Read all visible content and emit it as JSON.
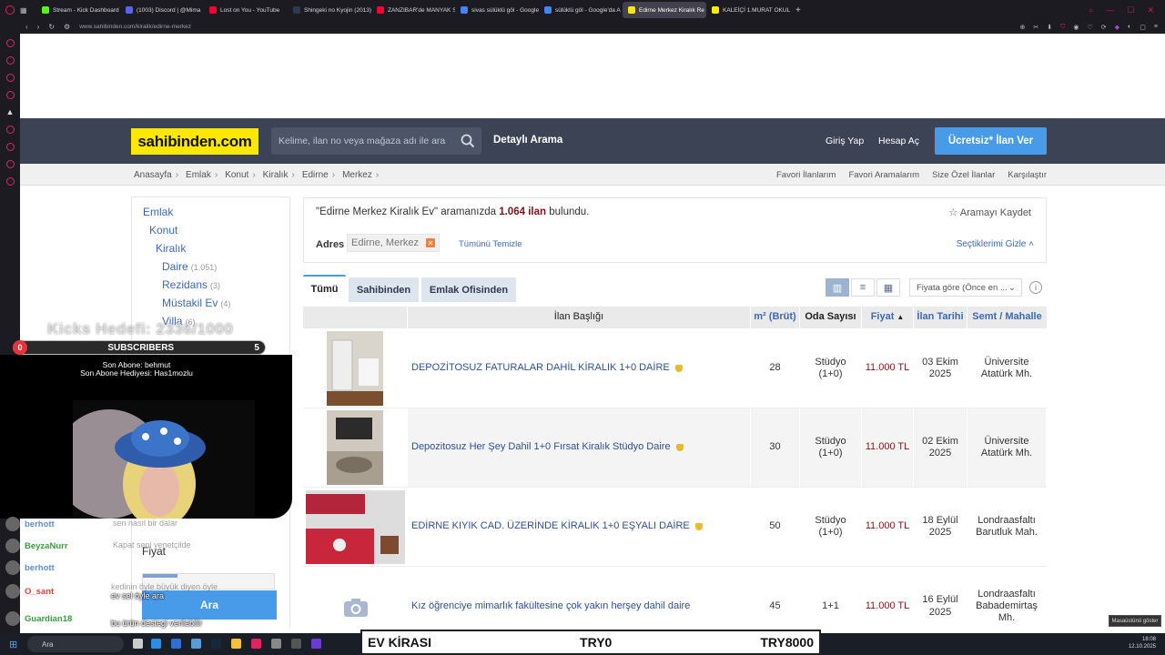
{
  "browser": {
    "tabs": [
      {
        "label": "Stream - Kick Dashboard",
        "color": "#53fc18"
      },
      {
        "label": "(1003) Discord | @Mima",
        "color": "#5865f2"
      },
      {
        "label": "Lost on You - YouTube",
        "color": "#ff0033"
      },
      {
        "label": "Shingeki no Kyojin (2013)",
        "color": "#2f3a52"
      },
      {
        "label": "ZANZIBAR'de MANYAK S",
        "color": "#ff0033"
      },
      {
        "label": "sivas sülüklü göl - Google",
        "color": "#4285f4"
      },
      {
        "label": "sülüklü göl - Google'da A",
        "color": "#4285f4"
      },
      {
        "label": "Edirne Merkez Kiralık Re",
        "color": "#ffe800"
      },
      {
        "label": "KALEİÇİ 1.MURAT OKULU",
        "color": "#ffe800"
      }
    ],
    "active_tab": 7,
    "new_tab": "+",
    "url": "www.sahibinden.com/kiralik/edirne-merkez"
  },
  "header": {
    "logo": "sahibinden.com",
    "search_placeholder": "Kelime, ilan no veya mağaza adı ile ara",
    "detailed_search": "Detaylı Arama",
    "login": "Giriş Yap",
    "register": "Hesap Aç",
    "post_ad": "Ücretsiz* İlan Ver"
  },
  "breadcrumb": {
    "items": [
      "Anasayfa",
      "Emlak",
      "Konut",
      "Kiralık",
      "Edirne",
      "Merkez"
    ],
    "right_links": [
      "Favori İlanlarım",
      "Favori Aramalarım",
      "Size Özel İlanlar",
      "Karşılaştır"
    ]
  },
  "categories": {
    "items": [
      {
        "label": "Emlak",
        "count": ""
      },
      {
        "label": "Konut",
        "count": ""
      },
      {
        "label": "Kiralık",
        "count": ""
      },
      {
        "label": "Daire",
        "count": "(1.051)"
      },
      {
        "label": "Rezidans",
        "count": "(3)"
      },
      {
        "label": "Müstakil Ev",
        "count": "(4)"
      },
      {
        "label": "Villa",
        "count": "(6)"
      }
    ],
    "price_label": "Fiyat",
    "search_button": "Ara"
  },
  "results": {
    "query": "\"Edirne Merkez Kiralık Ev\"",
    "middle": "aramanızda",
    "count": "1.064 ilan",
    "suffix": "bulundu.",
    "save_search": "Aramayı Kaydet",
    "address_label": "Adres",
    "address_chip": "Edirne, Merkez",
    "clear_all": "Tümünü Temizle",
    "hide_selected": "Seçtiklerimi Gizle"
  },
  "tabs": {
    "items": [
      "Tümü",
      "Sahibinden",
      "Emlak Ofisinden"
    ],
    "selected": 0,
    "sort": "Fiyata göre (Önce en ..."
  },
  "table": {
    "columns": [
      "İlan Başlığı",
      "m² (Brüt)",
      "Oda Sayısı",
      "Fiyat",
      "İlan Tarihi",
      "Semt / Mahalle"
    ],
    "rows": [
      {
        "title": "DEPOZİTOSUZ FATURALAR DAHİL KİRALIK 1+0 DAİRE",
        "m2": "28",
        "rooms": "Stüdyo (1+0)",
        "price": "11.000 TL",
        "date": "03 Ekim 2025",
        "area": "Üniversite Atatürk Mh."
      },
      {
        "title": "Depozitosuz Her Şey Dahil 1+0 Fırsat Kiralık Stüdyo Daire",
        "m2": "30",
        "rooms": "Stüdyo (1+0)",
        "price": "11.000 TL",
        "date": "02 Ekim 2025",
        "area": "Üniversite Atatürk Mh."
      },
      {
        "title": "EDİRNE KIYIK CAD. ÜZERİNDE KİRALIK 1+0 EŞYALI DAİRE",
        "m2": "50",
        "rooms": "Stüdyo (1+0)",
        "price": "11.000 TL",
        "date": "18 Eylül 2025",
        "area": "Londraasfaltı Barutluk Mah."
      },
      {
        "title": "Kız öğrenciye mimarlık fakültesine çok yakın herşey dahil daire",
        "m2": "45",
        "rooms": "1+1",
        "price": "11.000 TL",
        "date": "16 Eylül 2025",
        "area": "Londraasfaltı Babademirtaş Mh."
      }
    ]
  },
  "stream_overlay": {
    "goal": "Kicks Hedefi: 2336/1000",
    "sub_count_left": "0",
    "sub_label": "SUBSCRIBERS",
    "sub_count_right": "5",
    "last_sub": "Son Abone: behmut",
    "last_sub_gift": "Son Abone Hediyesi: Has1mozlu",
    "chat": [
      {
        "user": "berhott",
        "color": "#5b8dd9",
        "msg": "sen nasıl bir dalar"
      },
      {
        "user": "BeyzaNurr",
        "color": "#3aa13a",
        "msg": "Kapat seni yenetçilde"
      },
      {
        "user": "berhott",
        "color": "#5b8dd9",
        "msg": ""
      },
      {
        "user": "O_sant",
        "color": "#e04040",
        "msg": "ev sel öyle ara"
      },
      {
        "user": "Guardian18",
        "color": "#3aa13a",
        "msg": "bu ürün destegi verilebilir"
      }
    ],
    "chat_extra": "kedinin öyle büyük diyen öyle"
  },
  "ev_bar": {
    "left": "EV KİRASI",
    "middle": "TRY0",
    "right": "TRY8000"
  },
  "taskbar": {
    "search": "Ara",
    "time": "18:08",
    "date": "12.10.2025",
    "tooltip": "Masaüstünü göster"
  }
}
